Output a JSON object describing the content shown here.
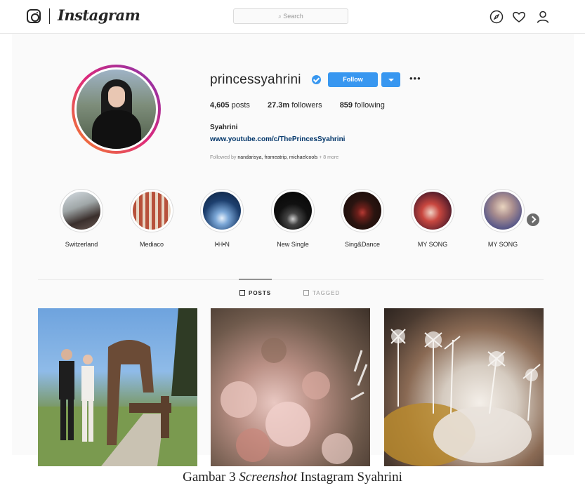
{
  "header": {
    "wordmark": "Instagram",
    "search_placeholder": "Search"
  },
  "profile": {
    "username": "princessyahrini",
    "verified": true,
    "follow_label": "Follow",
    "posts_count": "4,605",
    "posts_label": "posts",
    "followers_count": "27.3m",
    "followers_label": "followers",
    "following_count": "859",
    "following_label": "following",
    "full_name": "Syahrini",
    "link": "www.youtube.com/c/ThePrincesSyahrini",
    "followed_by_prefix": "Followed by",
    "followed_by_names": "nandarisya, frameatrip, michaelcools",
    "followed_by_suffix": "+ 8 more"
  },
  "highlights": [
    {
      "label": "Switzerland"
    },
    {
      "label": "Mediaco"
    },
    {
      "label": "I•H•N"
    },
    {
      "label": "New Single"
    },
    {
      "label": "Sing&Dance"
    },
    {
      "label": "MY SONG"
    },
    {
      "label": "MY SONG"
    }
  ],
  "tabs": {
    "posts": "POSTS",
    "tagged": "TAGGED"
  },
  "caption": {
    "prefix": "Gambar 3",
    "italic": "Screenshot",
    "suffix": "Instagram Syahrini"
  },
  "colors": {
    "accent": "#3897f0",
    "text": "#262626",
    "muted": "#8e8e8e",
    "link": "#003569"
  },
  "icons": [
    "instagram-logo-icon",
    "search-icon",
    "compass-icon",
    "heart-icon",
    "profile-icon",
    "verified-badge-icon",
    "more-options-icon",
    "chevron-right-icon",
    "grid-icon",
    "tagged-icon"
  ]
}
